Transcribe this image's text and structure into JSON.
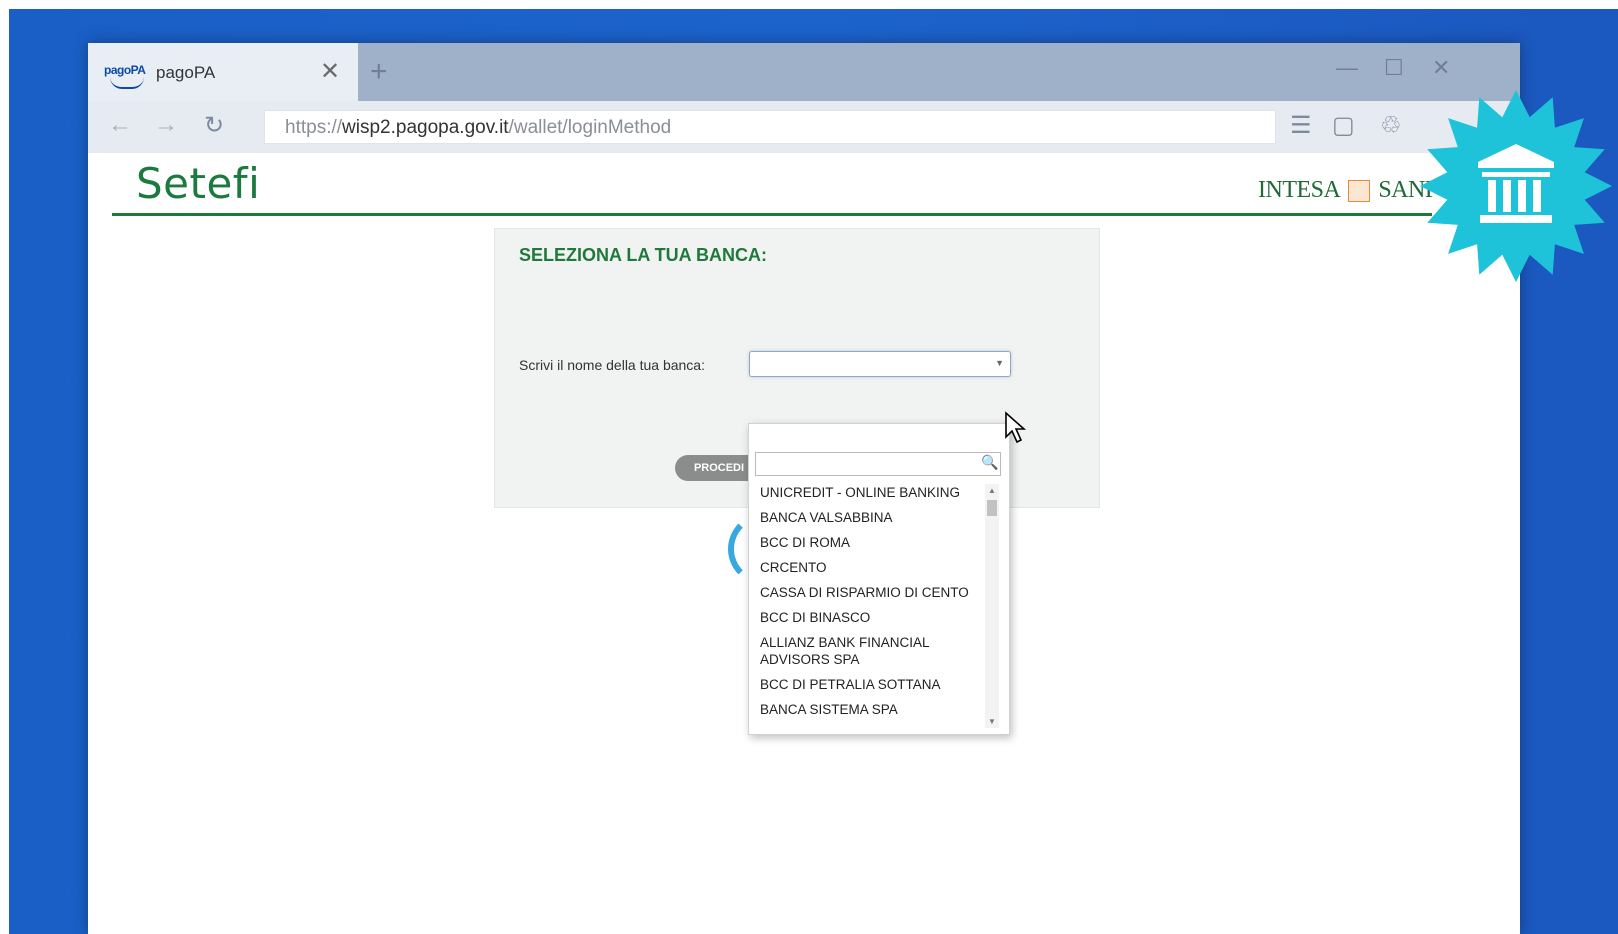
{
  "browser": {
    "tab_title": "pagoPA",
    "tab_logo_text": "pagoPA",
    "url_prefix": "https://",
    "url_host": "wisp2.pagopa.gov.it",
    "url_path": "/wallet/loginMethod"
  },
  "page": {
    "brand": "Setefi",
    "partner_logo_left": "INTESA",
    "partner_logo_right": "SANP",
    "card_title": "SELEZIONA LA TUA BANCA:",
    "bank_label": "Scrivi il nome della tua banca:",
    "proceed_label": "PROCEDI"
  },
  "dropdown": {
    "search_value": "",
    "options": [
      "UNICREDIT - ONLINE BANKING",
      "BANCA VALSABBINA",
      "BCC DI ROMA",
      "CRCENTO",
      "CASSA DI RISPARMIO DI CENTO",
      "BCC DI BINASCO",
      "ALLIANZ BANK FINANCIAL ADVISORS SPA",
      "BCC DI PETRALIA SOTTANA",
      "BANCA SISTEMA SPA"
    ]
  },
  "badge": {
    "icon": "bank-icon",
    "color": "#1ec3d9"
  }
}
